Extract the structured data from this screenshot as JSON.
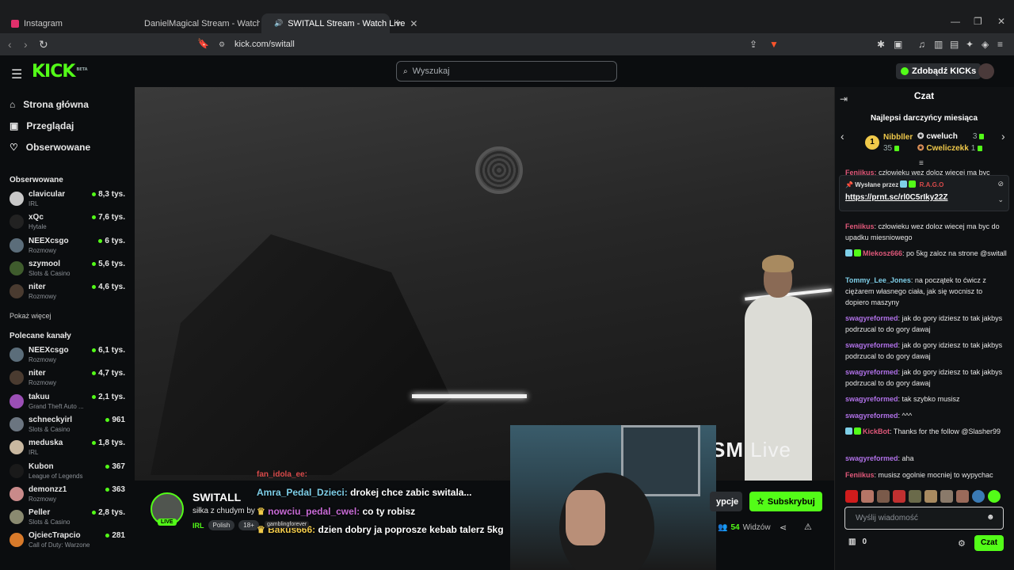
{
  "browser": {
    "tabs": [
      {
        "label": "Instagram",
        "color": "#e1306c"
      },
      {
        "label": "DanielMagical Stream - Watch Live o",
        "color": "#53fc18"
      },
      {
        "label": "SWITALL Stream - Watch Live",
        "color": "#53fc18"
      }
    ],
    "url": "kick.com/switall"
  },
  "header": {
    "logo": "KICK",
    "logo_tag": "BETA",
    "search_placeholder": "Wyszukaj",
    "kicks_button": "Zdobądź KICKs"
  },
  "sidebar": {
    "nav": [
      {
        "label": "Strona główna",
        "icon": "home-icon"
      },
      {
        "label": "Przeglądaj",
        "icon": "browse-icon"
      },
      {
        "label": "Obserwowane",
        "icon": "heart-icon"
      }
    ],
    "followed_title": "Obserwowane",
    "followed": [
      {
        "name": "clavicular",
        "category": "IRL",
        "viewers": "8,3 tys.",
        "color": "#c8c8c8"
      },
      {
        "name": "xQc",
        "category": "Hytale",
        "viewers": "7,6 tys.",
        "color": "#222"
      },
      {
        "name": "NEEXcsgo",
        "category": "Rozmowy",
        "viewers": "6 tys.",
        "color": "#5b6d7a"
      },
      {
        "name": "szymool",
        "category": "Slots & Casino",
        "viewers": "5,6 tys.",
        "color": "#3f5c2d"
      },
      {
        "name": "niter",
        "category": "Rozmowy",
        "viewers": "4,6 tys.",
        "color": "#4a3b30"
      }
    ],
    "show_more": "Pokaż więcej",
    "recommended_title": "Polecane kanały",
    "recommended": [
      {
        "name": "NEEXcsgo",
        "category": "Rozmowy",
        "viewers": "6,1 tys.",
        "color": "#5b6d7a"
      },
      {
        "name": "niter",
        "category": "Rozmowy",
        "viewers": "4,7 tys.",
        "color": "#4a3b30"
      },
      {
        "name": "takuu",
        "category": "Grand Theft Auto ...",
        "viewers": "2,1 tys.",
        "color": "#9b4fb5"
      },
      {
        "name": "schneckyirl",
        "category": "Slots & Casino",
        "viewers": "961",
        "color": "#6b7580"
      },
      {
        "name": "meduska",
        "category": "IRL",
        "viewers": "1,8 tys.",
        "color": "#c9b8a0"
      },
      {
        "name": "Kubon",
        "category": "League of Legends",
        "viewers": "367",
        "color": "#1a1a1a"
      },
      {
        "name": "demonzz1",
        "category": "Rozmowy",
        "viewers": "363",
        "color": "#c98a8a"
      },
      {
        "name": "Peller",
        "category": "Slots & Casino",
        "viewers": "2,8 tys.",
        "color": "#8a8a70"
      },
      {
        "name": "OjciecTrapcio",
        "category": "Call of Duty: Warzone",
        "viewers": "281",
        "color": "#d87a2a"
      }
    ]
  },
  "video": {
    "overlay_brand_bold": "RISM",
    "overlay_brand_light": " Live",
    "overlay_top_msg": "fan_idola_ee:",
    "overlay_msgs": [
      {
        "user": "Amra_Pedal_Dzieci:",
        "text": " drokej chce zabic switala..."
      },
      {
        "user": "nowciu_pedal_cwel:",
        "text": " co ty robisz"
      },
      {
        "user": "Bakus666:",
        "text": " dzien dobry ja poprosze kebab talerz 5kg"
      }
    ],
    "badge_text": "gamblingforever"
  },
  "stream": {
    "name": "SWITALL",
    "title": "siłka z chudym by",
    "live": "LIVE",
    "category": "IRL",
    "tags": [
      "Polish",
      "18+"
    ],
    "gift_label": "ypcje",
    "subscribe_label": "Subskrybuj",
    "viewers_count": "54",
    "viewers_label": "Widzów"
  },
  "chat": {
    "title": "Czat",
    "top_title": "Najlepsi darczyńcy miesiąca",
    "donors": [
      {
        "name": "Nibbller",
        "score": "35",
        "rank": "1"
      },
      {
        "name": "cweluch",
        "score": "3"
      },
      {
        "name": "Cweliczekk",
        "score": "1"
      }
    ],
    "pinned_by_label": "Wysłane przez",
    "pinned_by_user": "R.A.G.O",
    "pinned_link": "https://prnt.sc/rl0C5rIky22Z",
    "partial_msg_user": "Feniikus:",
    "partial_msg_text": " człowieku wez doloz wiecej ma byc",
    "messages": [
      {
        "user": "Feniikus",
        "color": "c-red",
        "text": ": człowieku wez doloz wiecej ma byc do upadku miesniowego"
      },
      {
        "user": "Mlekosz666",
        "color": "c-red",
        "text": ": po 5kg zaloz na strone @switall"
      },
      {
        "user": "Tommy_Lee_Jones",
        "color": "c-teal",
        "text": ": na początek to ćwicz z ciężarem własnego ciała, jak się wocnisz to dopiero maszyny"
      },
      {
        "user": "swagyreformed",
        "color": "c-purple",
        "text": ": jak do gory idziesz to tak jakbys podrzucal to do gory dawaj"
      },
      {
        "user": "swagyreformed",
        "color": "c-purple",
        "text": ": jak do gory idziesz to tak jakbys podrzucal to do gory dawaj"
      },
      {
        "user": "swagyreformed",
        "color": "c-purple",
        "text": ": jak do gory idziesz to tak jakbys podrzucal to do gory dawaj"
      },
      {
        "user": "swagyreformed",
        "color": "c-purple",
        "text": ": tak szybko musisz"
      },
      {
        "user": "swagyreformed",
        "color": "c-purple",
        "text": ": ^^^"
      },
      {
        "user": "KickBot",
        "color": "c-red",
        "text": ": Thanks for the follow @Slasher99"
      },
      {
        "user": "swagyreformed",
        "color": "c-purple",
        "text": ": aha"
      },
      {
        "user": "Feniikus",
        "color": "c-red",
        "text": ": musisz ogolnie mocniej to wypychac"
      }
    ],
    "input_placeholder": "Wyślij wiadomość",
    "points": "0",
    "send_label": "Czat"
  }
}
